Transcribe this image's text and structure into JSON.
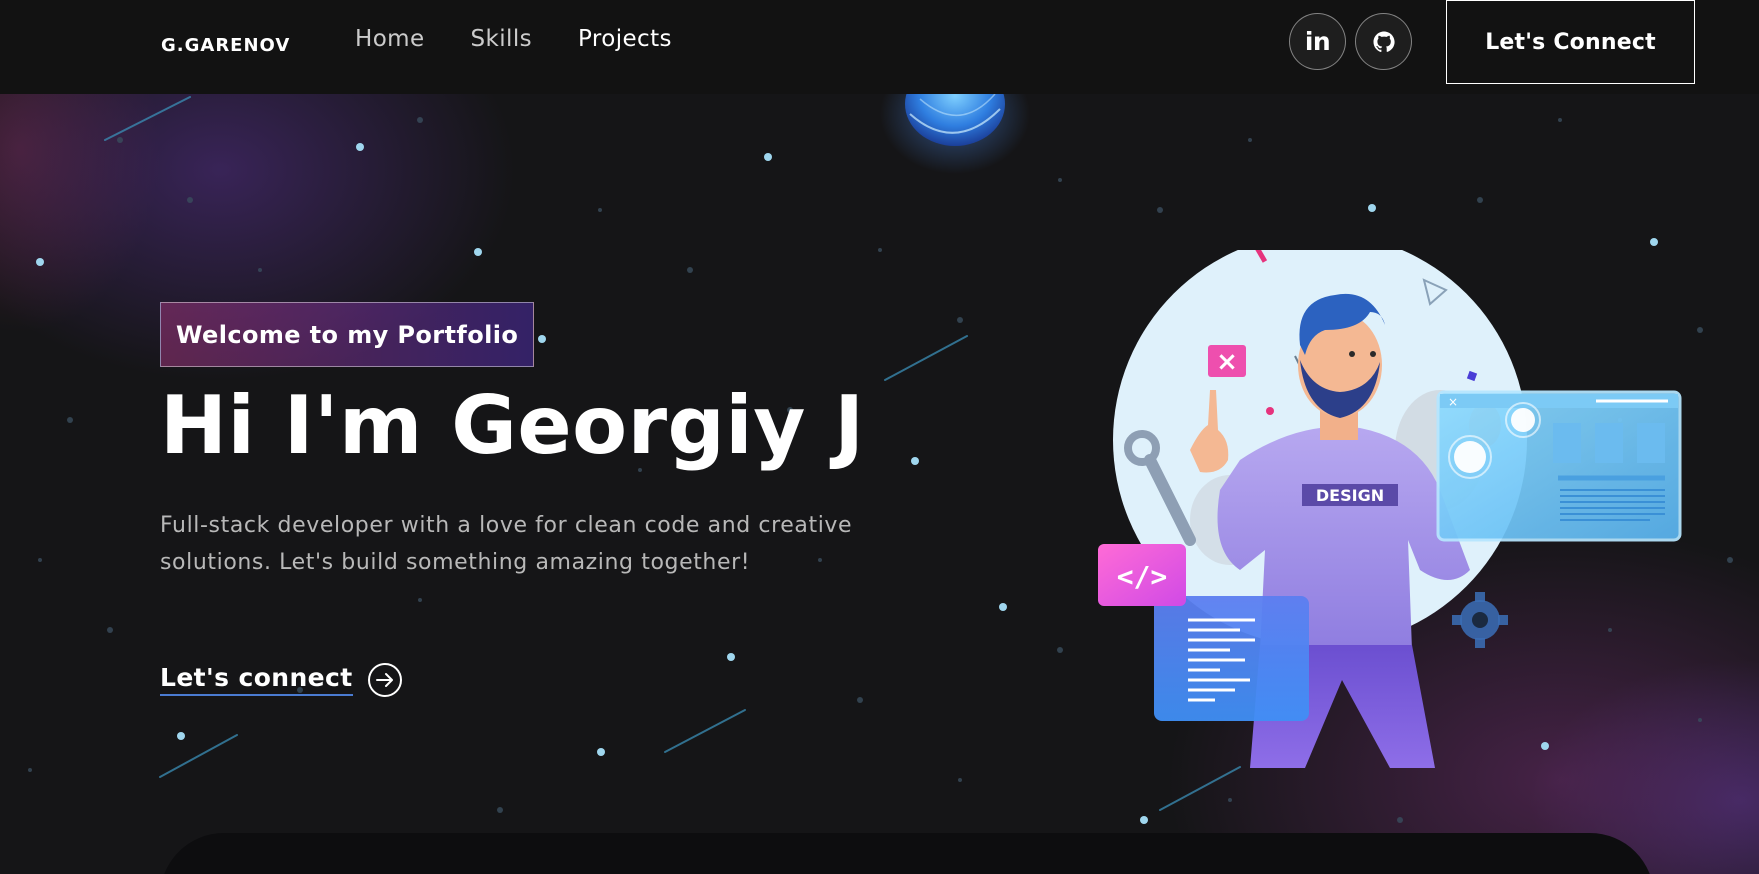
{
  "navbar": {
    "logo": "G.GARENOV",
    "links": [
      {
        "label": "Home"
      },
      {
        "label": "Skills"
      },
      {
        "label": "Projects"
      }
    ],
    "social": [
      {
        "icon": "linkedin-icon",
        "label": "in"
      },
      {
        "icon": "github-icon"
      }
    ],
    "connect_label": "Let's Connect"
  },
  "hero": {
    "tagline": "Welcome to my Portfolio",
    "title": "Hi I'm Georgiy J",
    "description": "Full-stack developer with a love for clean code and creative solutions. Let's build something amazing together!",
    "cta_label": "Let's connect",
    "cta_icon": "arrow-right-circle-icon"
  },
  "illustration": {
    "shirt_text": "DESIGN",
    "code_tag": "</>"
  },
  "colors": {
    "background": "#151517",
    "navbar": "#121212",
    "tagline_gradient_start": "#aa367c",
    "tagline_gradient_end": "#4a2fbd",
    "description": "#b8b8b8",
    "cta_underline": "#4a7bd1"
  }
}
